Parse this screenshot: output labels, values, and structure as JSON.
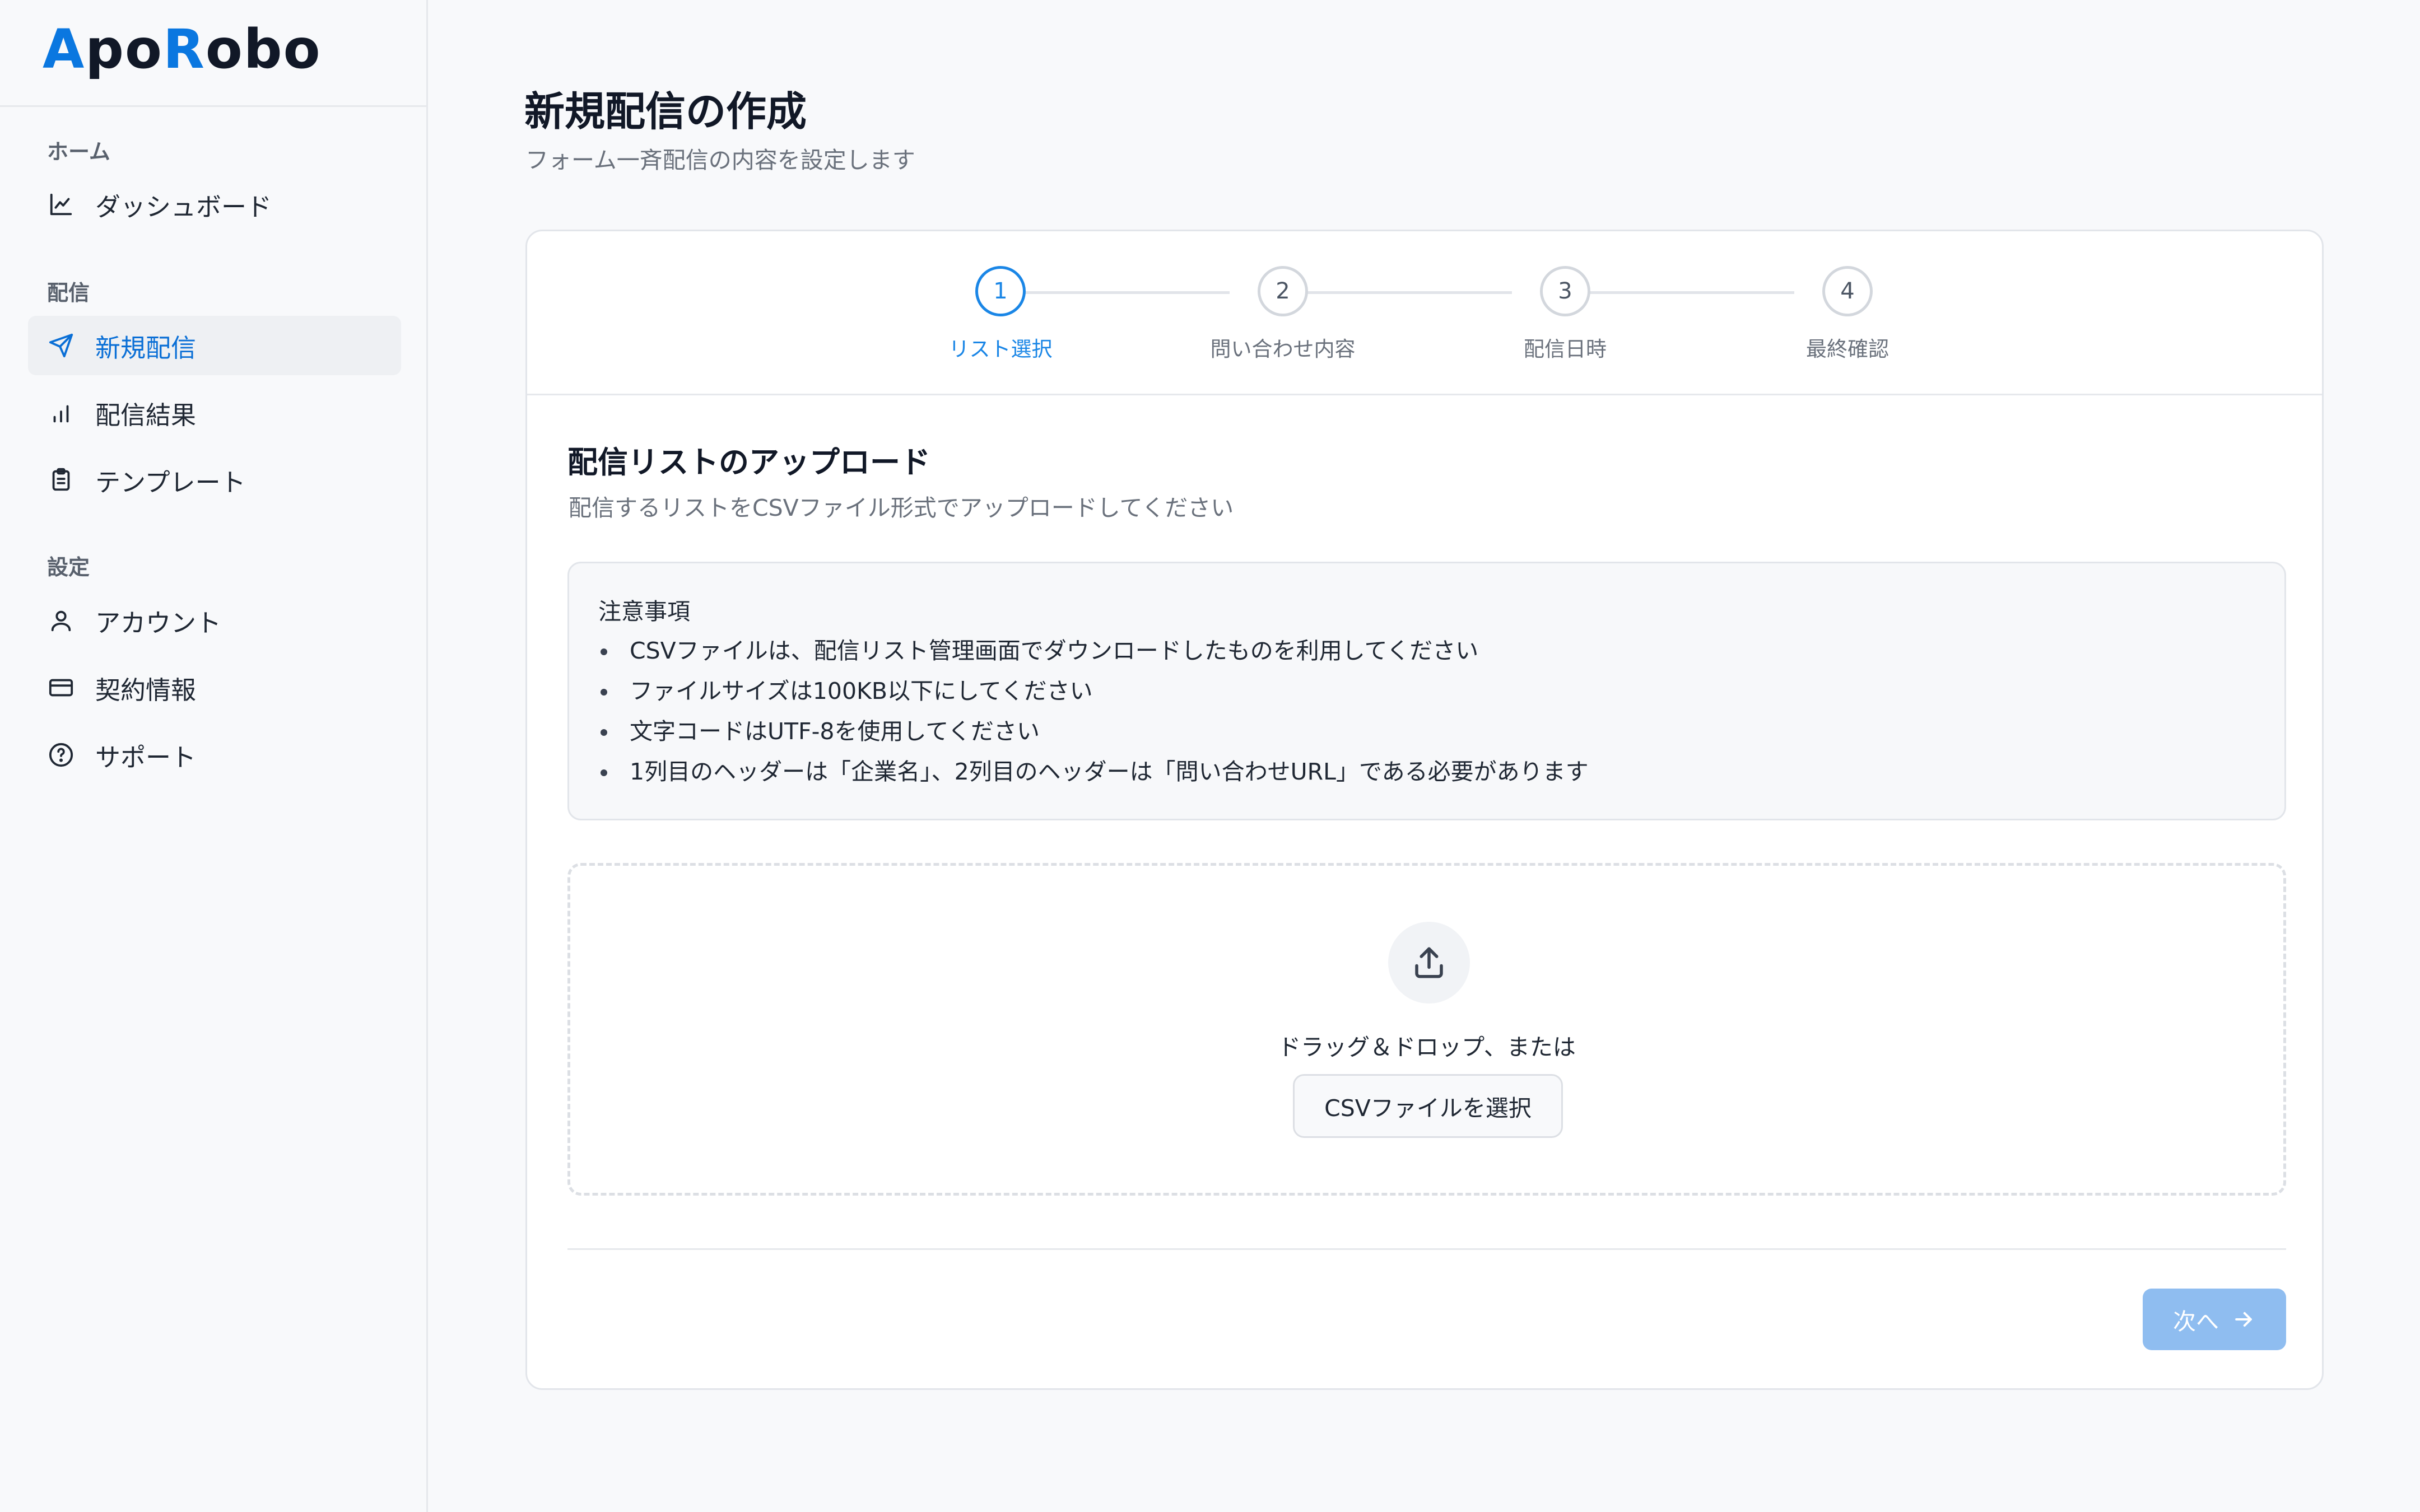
{
  "logo": {
    "part1": "A",
    "part2": "po",
    "part3": "R",
    "part4": "obo"
  },
  "sidebar": {
    "sections": [
      {
        "label": "ホーム"
      },
      {
        "label": "配信"
      },
      {
        "label": "設定"
      }
    ],
    "items": [
      {
        "label": "ダッシュボード",
        "icon": "chart-line-icon"
      },
      {
        "label": "新規配信",
        "icon": "send-icon",
        "active": true
      },
      {
        "label": "配信結果",
        "icon": "bar-chart-icon"
      },
      {
        "label": "テンプレート",
        "icon": "clipboard-icon"
      },
      {
        "label": "アカウント",
        "icon": "user-icon"
      },
      {
        "label": "契約情報",
        "icon": "credit-card-icon"
      },
      {
        "label": "サポート",
        "icon": "help-circle-icon"
      }
    ]
  },
  "header": {
    "title": "新規配信の作成",
    "subtitle": "フォーム一斉配信の内容を設定します"
  },
  "stepper": {
    "current": 1,
    "steps": [
      {
        "number": "1",
        "label": "リスト選択"
      },
      {
        "number": "2",
        "label": "問い合わせ内容"
      },
      {
        "number": "3",
        "label": "配信日時"
      },
      {
        "number": "4",
        "label": "最終確認"
      }
    ]
  },
  "upload_section": {
    "title": "配信リストのアップロード",
    "description": "配信するリストをCSVファイル形式でアップロードしてください"
  },
  "notice": {
    "title": "注意事項",
    "items": [
      "CSVファイルは、配信リスト管理画面でダウンロードしたものを利用してください",
      "ファイルサイズは100KB以下にしてください",
      "文字コードはUTF-8を使用してください",
      "1列目のヘッダーは「企業名」、2列目のヘッダーは「問い合わせURL」である必要があります"
    ]
  },
  "dropzone": {
    "text": "ドラッグ＆ドロップ、または",
    "button_label": "CSVファイルを選択",
    "icon": "upload-icon"
  },
  "footer": {
    "next_label": "次へ",
    "next_icon": "arrow-right-icon",
    "next_enabled": false
  },
  "colors": {
    "accent": "#1a86e6",
    "brand": "#0a77e0",
    "next_disabled": "#8fbdf0"
  }
}
